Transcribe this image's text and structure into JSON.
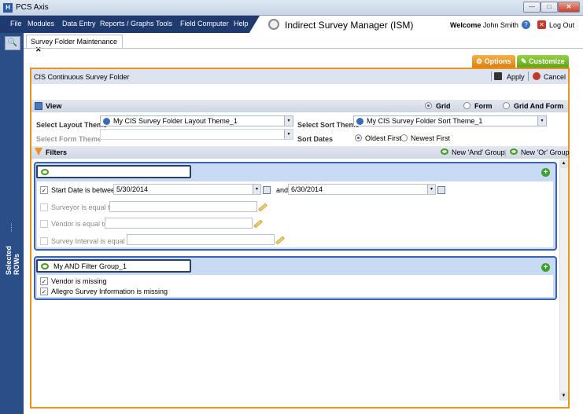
{
  "window": {
    "app_icon": "H",
    "title": "PCS Axis",
    "min": "—",
    "max": "□",
    "close": "✕"
  },
  "menu": [
    "File",
    "Modules",
    "Data Entry",
    "Reports / Graphs",
    "Tools",
    "Field Computer",
    "Help"
  ],
  "module_title": "Indirect Survey Manager (ISM)",
  "user": {
    "welcome": "Welcome",
    "name": "John Smith",
    "help_icon": "?",
    "logout_icon": "✕",
    "logout": "Log Out"
  },
  "sidebar": {
    "search_icon": "🔍",
    "selected_rows": "Selected ROWs",
    "dots": "....."
  },
  "tab": {
    "label": "Survey Folder Maintenance",
    "close": "✕"
  },
  "actions": {
    "options": "Options",
    "customize": "Customize"
  },
  "panel": {
    "title": "CIS Continuous Survey Folder",
    "apply": "Apply",
    "cancel": "Cancel"
  },
  "view": {
    "label": "View",
    "modes": [
      "Grid",
      "Form",
      "Grid And Form"
    ],
    "selected_mode": "Grid",
    "select_layout_theme_label": "Select Layout Theme",
    "layout_theme": "My CIS Survey Folder Layout Theme_1",
    "select_form_theme_label": "Select Form Theme",
    "form_theme": "",
    "select_sort_theme_label": "Select Sort Theme",
    "sort_theme": "My CIS Survey Folder Sort Theme_1",
    "sort_dates_label": "Sort Dates",
    "sort_options": [
      "Oldest First",
      "Newest First"
    ],
    "selected_sort": "Oldest First"
  },
  "filters": {
    "label": "Filters",
    "new_and": "New 'And' Group",
    "new_or": "New 'Or' Group",
    "separator": "|",
    "add": "+",
    "dd": "▾",
    "check": "✓",
    "scroll_up": "▲",
    "scroll_down": "▼",
    "groups": [
      {
        "name": "",
        "rows": [
          {
            "checked": true,
            "label": "Start Date is between",
            "value": "5/30/2014",
            "and_label": "and",
            "value2": "6/30/2014"
          },
          {
            "checked": false,
            "label": "Surveyor is equal to",
            "value": ""
          },
          {
            "checked": false,
            "label": "Vendor is equal to",
            "value": ""
          },
          {
            "checked": false,
            "label": "Survey Interval is equal to",
            "value": ""
          }
        ]
      },
      {
        "name": "My AND Filter Group_1",
        "rows": [
          {
            "checked": true,
            "label": "Vendor is missing"
          },
          {
            "checked": true,
            "label": "Allegro Survey Information is missing"
          }
        ]
      }
    ]
  },
  "colors": {
    "accent_orange": "#e8951f",
    "accent_green": "#5fa418",
    "nav_blue": "#1e3a6e"
  }
}
